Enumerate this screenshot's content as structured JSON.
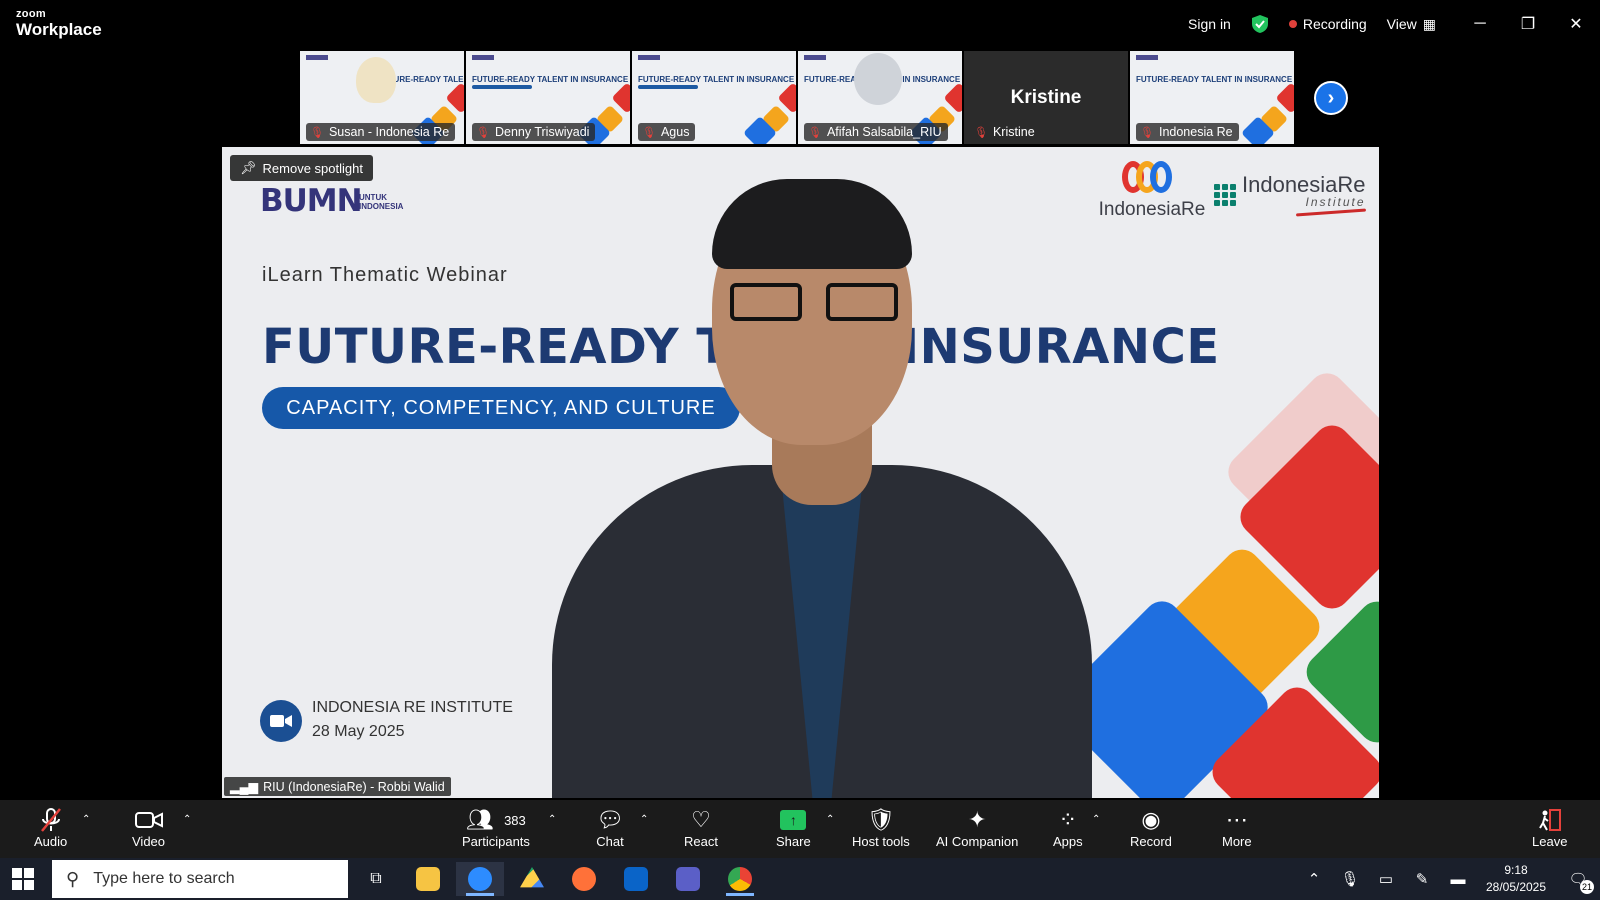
{
  "titlebar": {
    "brand_small": "zoom",
    "brand_big": "Workplace",
    "sign_in": "Sign in",
    "recording": "Recording",
    "view": "View"
  },
  "thumbnails": [
    {
      "name": "Susan - Indonesia Re",
      "mini_title": "FUTURE-READY TALENT IN INSURANCE"
    },
    {
      "name": "Denny Triswiyadi",
      "mini_title": "FUTURE-READY TALENT IN INSURANCE"
    },
    {
      "name": "Agus",
      "mini_title": "FUTURE-READY TALENT IN INSURANCE"
    },
    {
      "name": "Afifah Salsabila_RIU",
      "mini_title": "FUTURE-READY TALENT IN INSURANCE"
    },
    {
      "name": "Kristine",
      "center_name": "Kristine"
    },
    {
      "name": "Indonesia Re",
      "mini_title": "FUTURE-READY TALENT IN INSURANCE"
    }
  ],
  "stage": {
    "remove_spotlight": "Remove spotlight",
    "bumn": "BUMN",
    "bumn_sub": "UNTUK\nINDONESIA",
    "webinar": "iLearn Thematic Webinar",
    "headline": "FUTURE-READY TA        INSURANCE",
    "pill": "CAPACITY, COMPETENCY, AND CULTURE",
    "logo1": "IndonesiaRe",
    "logo2_t1": "IndonesiaRe",
    "logo2_t2": "Institute",
    "institute": "INDONESIA RE INSTITUTE",
    "date": "28 May 2025",
    "speaker": "RIU (IndonesiaRe) - Robbi Walid"
  },
  "toolbar": {
    "audio": "Audio",
    "video": "Video",
    "participants": "Participants",
    "participants_count": "383",
    "chat": "Chat",
    "react": "React",
    "share": "Share",
    "host_tools": "Host tools",
    "ai_companion": "AI Companion",
    "apps": "Apps",
    "record": "Record",
    "more": "More",
    "leave": "Leave"
  },
  "taskbar": {
    "search_placeholder": "Type here to search",
    "time": "9:18",
    "date": "28/05/2025",
    "notif_count": "21"
  },
  "colors": {
    "recording_dot": "#e0413b",
    "secure_shield": "#22c35e",
    "headline_blue": "#1d3a72",
    "pill_blue": "#1658a9",
    "share_green": "#22c35e",
    "accent_blue": "#1a73e8"
  }
}
